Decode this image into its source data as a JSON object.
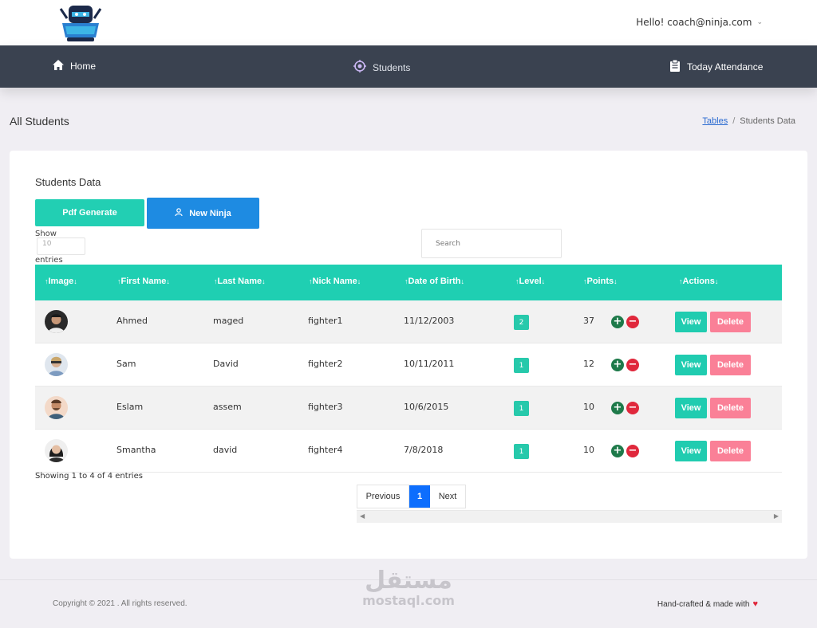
{
  "header": {
    "user_greeting": "Hello! coach@ninja.com"
  },
  "nav": {
    "home": "Home",
    "students": "Students",
    "attendance": "Today Attendance"
  },
  "page": {
    "title": "All Students",
    "breadcrumb_link": "Tables",
    "breadcrumb_current": "Students Data"
  },
  "card": {
    "title": "Students Data",
    "pdf_button": "Pdf Generate",
    "new_button": "New Ninja",
    "show_label": "Show",
    "show_value": "10",
    "entries_label": "entries",
    "search_placeholder": "Search"
  },
  "table": {
    "columns": [
      "Image",
      "First Name",
      "Last Name",
      "Nick Name",
      "Date of Birth",
      "Level",
      "Points",
      "Actions"
    ],
    "rows": [
      {
        "first": "Ahmed",
        "last": "maged",
        "nick": "fighter1",
        "dob": "11/12/2003",
        "level": "2",
        "points": "37"
      },
      {
        "first": "Sam",
        "last": "David",
        "nick": "fighter2",
        "dob": "10/11/2011",
        "level": "1",
        "points": "12"
      },
      {
        "first": "Eslam",
        "last": "assem",
        "nick": "fighter3",
        "dob": "10/6/2015",
        "level": "1",
        "points": "10"
      },
      {
        "first": "Smantha",
        "last": "david",
        "nick": "fighter4",
        "dob": "7/8/2018",
        "level": "1",
        "points": "10"
      }
    ],
    "view_label": "View",
    "delete_label": "Delete"
  },
  "info_text": "Showing 1 to 4 of 4 entries",
  "pagination": {
    "previous": "Previous",
    "current": "1",
    "next": "Next"
  },
  "footer": {
    "copyright": "Copyright © 2021 . All rights reserved.",
    "made_with": "Hand-crafted & made with",
    "watermark_ar": "مستقل",
    "watermark_en": "mostaql.com"
  },
  "colors": {
    "accent_teal": "#1fcfb2",
    "primary_blue": "#1e8be2",
    "danger_pink": "#fa8097",
    "nav_dark": "#3a4250"
  },
  "icons": {
    "home": "home-icon",
    "students": "crosshair-icon",
    "attendance": "clipboard-icon",
    "new_ninja": "user-icon",
    "heart": "heart-icon"
  }
}
